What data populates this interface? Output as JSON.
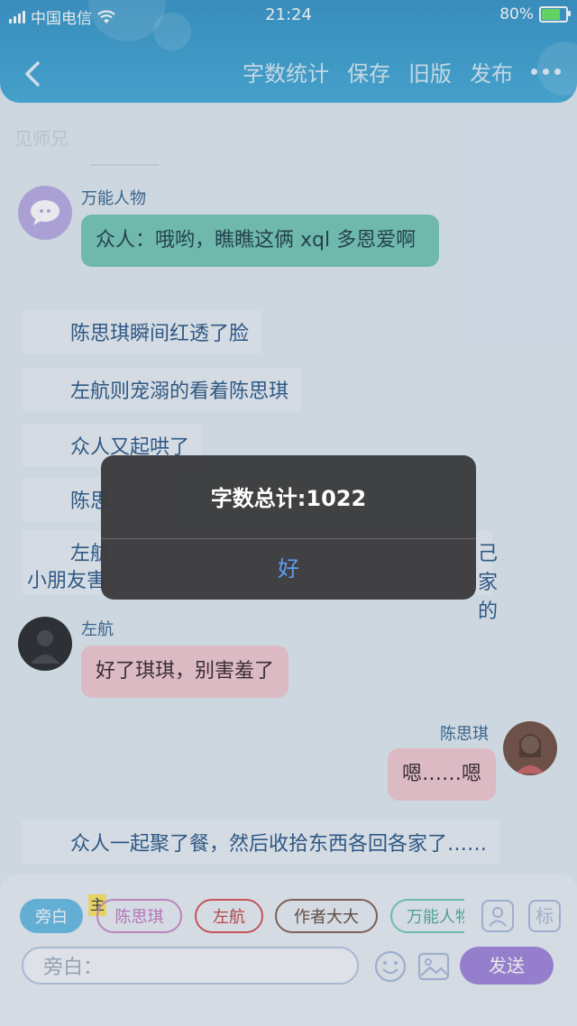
{
  "status": {
    "carrier": "中国电信",
    "time": "21:24",
    "battery": "80%",
    "battery_level": 0.8
  },
  "nav": {
    "actions": [
      "字数统计",
      "保存",
      "旧版",
      "发布"
    ],
    "partial_line": "见师兄"
  },
  "chat": {
    "m1_name": "万能人物",
    "m1_text": "众人：哦哟，瞧瞧这俩 xql 多恩爱啊",
    "n1": "陈思琪瞬间红透了脸",
    "n2": "左航则宠溺的看着陈思琪",
    "n3": "众人又起哄了",
    "n4_visible": "陈思",
    "n5_line1_left": "左航",
    "n5_line1_right": "己家的",
    "n5_line2": "小朋友害",
    "m2_name": "左航",
    "m2_text": "好了琪琪，别害羞了",
    "m3_name": "陈思琪",
    "m3_text": "嗯……嗯",
    "n6": "众人一起聚了餐，然后收拾东西各回各家了……"
  },
  "composer": {
    "chips": [
      "旁白",
      "陈思琪",
      "左航",
      "作者大大",
      "万能人物"
    ],
    "main_badge": "主",
    "placeholder": "旁白：",
    "send": "发送",
    "tag_label": "标"
  },
  "dialog": {
    "message": "字数总计:1022",
    "ok": "好"
  },
  "colors": {
    "header": "#2a8fc4",
    "bubble_mint": "#6cc5b0",
    "bubble_pink": "#f2c6cf",
    "narration_text": "#1e4f82",
    "send_button": "#9b7ed8",
    "dialog_ok": "#5d9df5"
  }
}
